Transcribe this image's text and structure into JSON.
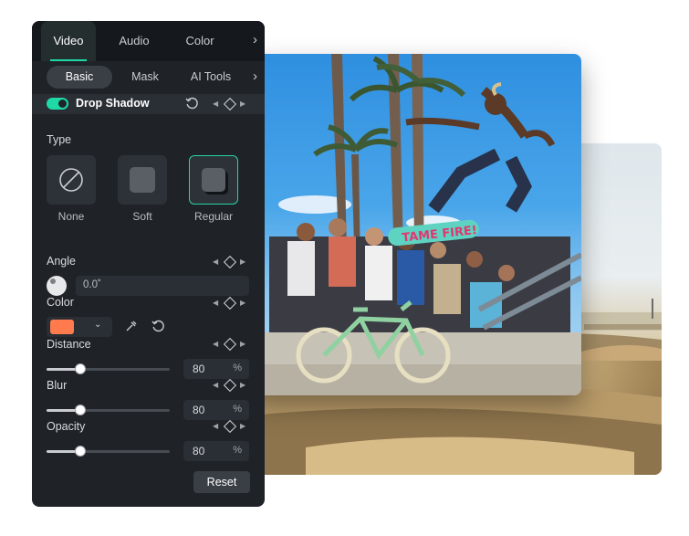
{
  "tabs": [
    {
      "label": "Video",
      "active": true
    },
    {
      "label": "Audio",
      "active": false
    },
    {
      "label": "Color",
      "active": false
    }
  ],
  "subtabs": [
    {
      "label": "Basic",
      "active": true
    },
    {
      "label": "Mask",
      "active": false
    },
    {
      "label": "AI Tools",
      "active": false
    }
  ],
  "drop_shadow": {
    "label": "Drop Shadow",
    "enabled": true
  },
  "type": {
    "label": "Type",
    "options": [
      {
        "label": "None",
        "selected": false
      },
      {
        "label": "Soft",
        "selected": false
      },
      {
        "label": "Regular",
        "selected": true
      }
    ]
  },
  "angle": {
    "label": "Angle",
    "value": "0.0˚"
  },
  "color": {
    "label": "Color",
    "swatch": "#ff7a4d"
  },
  "distance": {
    "label": "Distance",
    "value": "80",
    "unit": "%",
    "level": 0.27
  },
  "blur": {
    "label": "Blur",
    "value": "80",
    "unit": "%",
    "level": 0.27
  },
  "opacity": {
    "label": "Opacity",
    "value": "80",
    "unit": "%",
    "level": 0.27
  },
  "reset_label": "Reset",
  "photo_text": "TAME FIRE!",
  "colors": {
    "accent": "#1ed8a6",
    "panel": "#1f2328"
  }
}
